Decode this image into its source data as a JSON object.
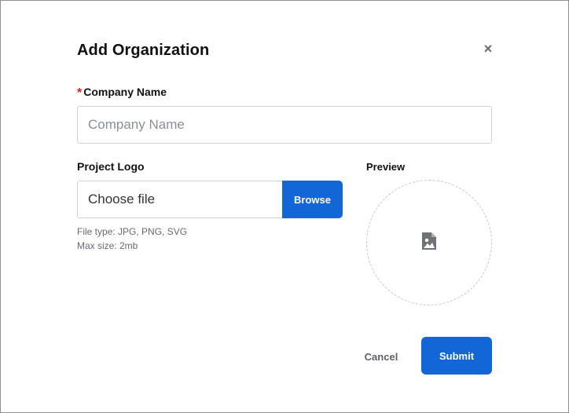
{
  "dialog": {
    "title": "Add Organization",
    "close_glyph": "×",
    "close_icon": "close-icon"
  },
  "company": {
    "required_marker": "*",
    "label": "Company Name",
    "value": "",
    "placeholder": "Company Name"
  },
  "logo": {
    "label": "Project Logo",
    "file_text": "Choose file",
    "browse_label": "Browse",
    "hint_type": "File type: JPG, PNG, SVG",
    "hint_size": "Max size: 2mb"
  },
  "preview": {
    "label": "Preview",
    "icon": "image-placeholder-icon"
  },
  "actions": {
    "cancel_label": "Cancel",
    "submit_label": "Submit"
  },
  "colors": {
    "accent": "#1266d6",
    "required": "#e01b1b"
  }
}
